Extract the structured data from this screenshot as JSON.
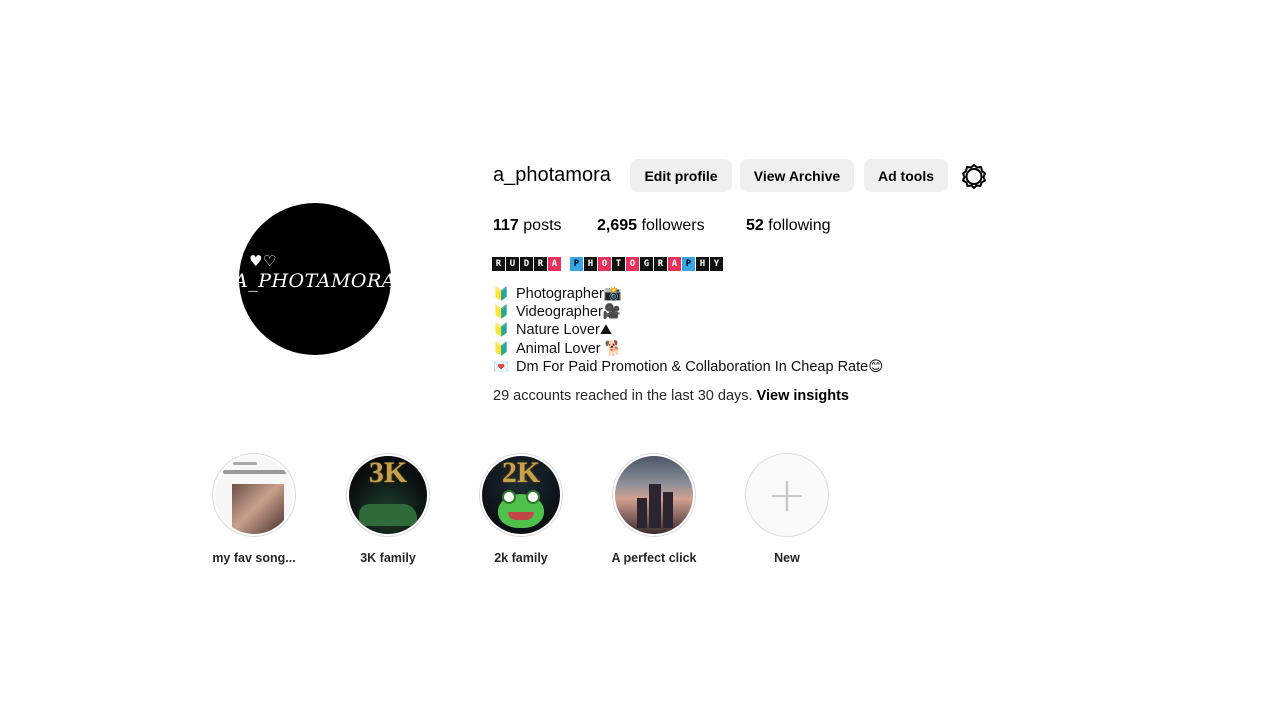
{
  "profile": {
    "username": "a_photamora",
    "avatar_text": "A_PHOTAMORA",
    "buttons": {
      "edit": "Edit profile",
      "archive": "View Archive",
      "ad_tools": "Ad tools"
    },
    "settings_icon": "gear-icon",
    "stats": {
      "posts_count": "117",
      "posts_label": "posts",
      "followers_count": "2,695",
      "followers_label": "followers",
      "following_count": "52",
      "following_label": "following"
    },
    "display_name_part1": [
      "R",
      "U",
      "D",
      "R",
      "A"
    ],
    "display_name_part2": [
      "P",
      "H",
      "O",
      "T",
      "O",
      "G",
      "R",
      "A",
      "P",
      "H",
      "Y"
    ],
    "bio_lines": [
      {
        "bullet": "🔰",
        "text": "Photographer📸"
      },
      {
        "bullet": "🔰",
        "text": "Videographer🎥"
      },
      {
        "bullet": "🔰",
        "text": "Nature Lover⛰"
      },
      {
        "bullet": "🔰",
        "text": "Animal Lover 🐕"
      },
      {
        "bullet": "💌",
        "text": "Dm For Paid Promotion & Collaboration In Cheap Rate😊"
      }
    ],
    "insights_text": "29 accounts reached in the last 30 days.",
    "insights_link": "View insights"
  },
  "highlights": [
    {
      "label": "my fav song..."
    },
    {
      "label": "3K family",
      "badge": "3K"
    },
    {
      "label": "2k family",
      "badge": "2K"
    },
    {
      "label": "A perfect click"
    },
    {
      "label": "New"
    }
  ],
  "colors": {
    "button_bg": "#efefef",
    "accent_red": "#e8305a",
    "accent_blue": "#36a6e6"
  }
}
